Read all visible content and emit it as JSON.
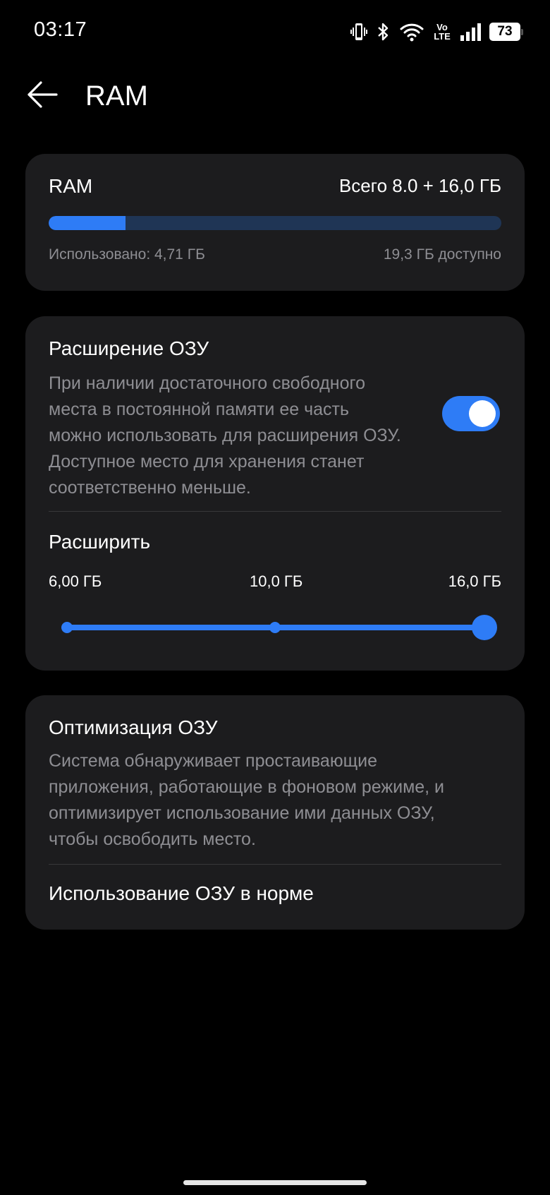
{
  "status_bar": {
    "time": "03:17",
    "volte_top": "Vo",
    "volte_bottom": "LTE",
    "battery": "73",
    "icons": [
      "vibrate-icon",
      "bluetooth-icon",
      "wifi-icon",
      "volte-icon",
      "signal-icon",
      "battery-icon"
    ]
  },
  "header": {
    "title": "RAM",
    "back_icon": "arrow-left-icon"
  },
  "ram_card": {
    "label": "RAM",
    "total": "Всего 8.0 + 16,0 ГБ",
    "used": "Использовано: 4,71 ГБ",
    "available": "19,3 ГБ доступно",
    "usage_fraction": 0.17
  },
  "expansion_card": {
    "title": "Расширение ОЗУ",
    "description_lines": [
      "При наличии достаточного свободного",
      "места в постоянной памяти ее часть",
      "можно использовать для расширения ОЗУ.",
      "Доступное место для хранения станет",
      "соответственно меньше."
    ],
    "toggle_on": true,
    "expand_title": "Расширить",
    "slider_options": [
      "6,00 ГБ",
      "10,0 ГБ",
      "16,0 ГБ"
    ],
    "slider_selected": "16,0 ГБ"
  },
  "optimization_card": {
    "title": "Оптимизация ОЗУ",
    "description_lines": [
      "Система обнаруживает простаивающие",
      "приложения, работающие в фоновом режиме, и",
      "оптимизирует использование ими данных ОЗУ,",
      "чтобы освободить место."
    ],
    "status": "Использование ОЗУ в норме"
  },
  "colors": {
    "accent": "#2e7cf6",
    "card_bg": "#1c1c1e",
    "secondary_text": "#8e8e93",
    "track_bg": "#1f3555"
  }
}
